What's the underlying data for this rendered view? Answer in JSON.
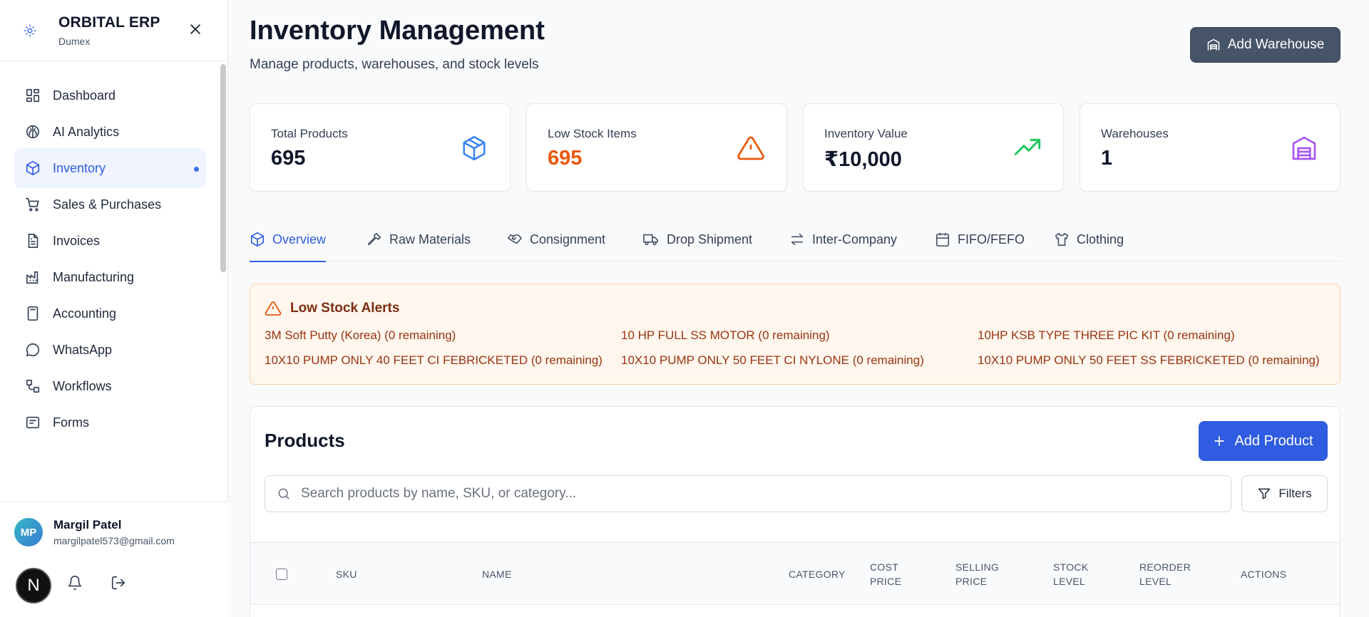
{
  "brand": {
    "title": "ORBITAL ERP",
    "subtitle": "Dumex"
  },
  "nav": [
    {
      "label": "Dashboard",
      "icon": "dashboard-icon"
    },
    {
      "label": "AI Analytics",
      "icon": "brain-icon"
    },
    {
      "label": "Inventory",
      "icon": "package-icon",
      "active": true
    },
    {
      "label": "Sales & Purchases",
      "icon": "cart-icon"
    },
    {
      "label": "Invoices",
      "icon": "file-text-icon"
    },
    {
      "label": "Manufacturing",
      "icon": "factory-icon"
    },
    {
      "label": "Accounting",
      "icon": "calculator-icon"
    },
    {
      "label": "WhatsApp",
      "icon": "message-circle-icon"
    },
    {
      "label": "Workflows",
      "icon": "workflow-icon"
    },
    {
      "label": "Forms",
      "icon": "form-icon"
    }
  ],
  "user": {
    "initials": "MP",
    "name": "Margil Patel",
    "email": "margilpatel573@gmail.com",
    "badge_letter": "N"
  },
  "header": {
    "title": "Inventory Management",
    "subtitle": "Manage products, warehouses, and stock levels",
    "add_warehouse_label": "Add Warehouse"
  },
  "stats": [
    {
      "label": "Total Products",
      "value": "695",
      "icon": "package-icon",
      "color": "#3b82f6"
    },
    {
      "label": "Low Stock Items",
      "value": "695",
      "icon": "alert-triangle-icon",
      "color": "#ea580c"
    },
    {
      "label": "Inventory Value",
      "value": "₹10,000",
      "icon": "trending-up-icon",
      "color": "#22c55e"
    },
    {
      "label": "Warehouses",
      "value": "1",
      "icon": "warehouse-icon",
      "color": "#a855f7"
    }
  ],
  "tabs": [
    {
      "label": "Overview",
      "icon": "package-icon",
      "active": true
    },
    {
      "label": "Raw Materials",
      "icon": "hammer-icon"
    },
    {
      "label": "Consignment",
      "icon": "handshake-icon"
    },
    {
      "label": "Drop Shipment",
      "icon": "truck-icon"
    },
    {
      "label": "Inter-Company",
      "icon": "arrows-exchange-icon"
    },
    {
      "label": "FIFO/FEFO",
      "icon": "calendar-icon"
    },
    {
      "label": "Clothing",
      "icon": "shirt-icon"
    }
  ],
  "alerts": {
    "title": "Low Stock Alerts",
    "items": [
      "3M Soft Putty (Korea) (0 remaining)",
      "10 HP FULL SS MOTOR (0 remaining)",
      "10HP KSB TYPE THREE PIC KIT (0 remaining)",
      "10X10 PUMP ONLY 40 FEET CI FEBRICKETED (0 remaining)",
      "10X10 PUMP ONLY 50 FEET CI NYLONE (0 remaining)",
      "10X10 PUMP ONLY 50 FEET SS FEBRICKETED (0 remaining)"
    ]
  },
  "products": {
    "title": "Products",
    "add_label": "Add Product",
    "search_placeholder": "Search products by name, SKU, or category...",
    "filters_label": "Filters",
    "columns": [
      "SKU",
      "NAME",
      "CATEGORY",
      "COST PRICE",
      "SELLING PRICE",
      "STOCK LEVEL",
      "REORDER LEVEL",
      "ACTIONS"
    ]
  },
  "colors": {
    "accent": "#2f5ce0",
    "dark_button": "#475467",
    "alert_bg": "#fff6ed",
    "alert_text": "#9a3412"
  }
}
